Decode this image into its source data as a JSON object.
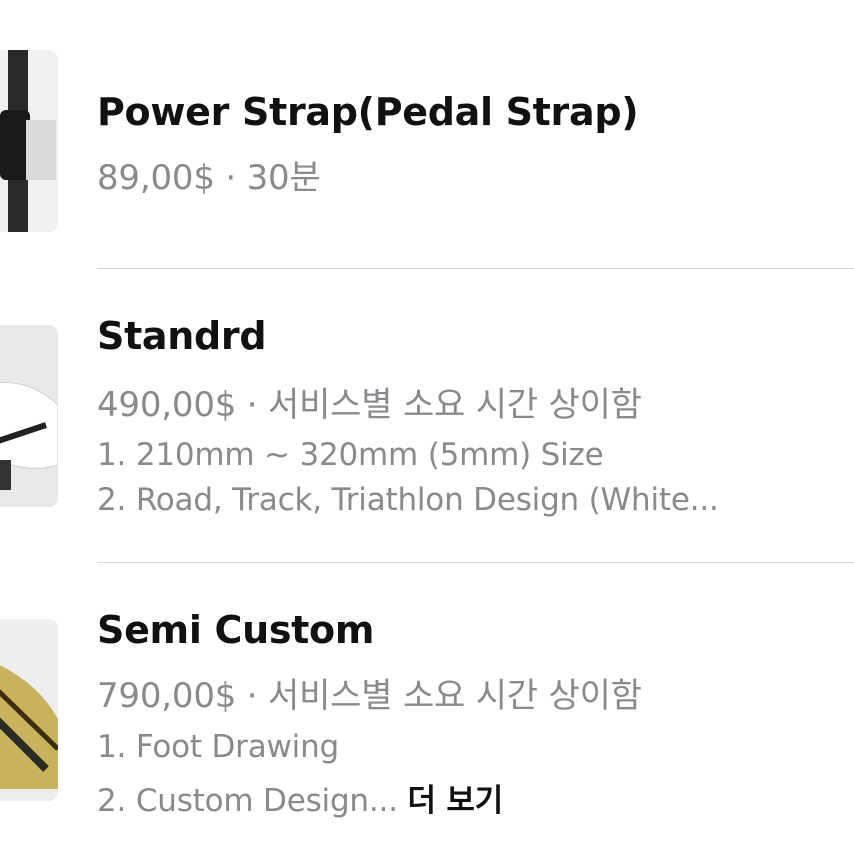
{
  "items": [
    {
      "title": "Power Strap(Pedal Strap)",
      "meta": "89,00$ · 30분",
      "desc1": "",
      "desc2": ""
    },
    {
      "title": "Standrd",
      "meta": "490,00$ · 서비스별 소요 시간 상이함",
      "desc1": "1. 210mm ~ 320mm (5mm) Size",
      "desc2": "2. Road, Track, Triathlon Design (White..."
    },
    {
      "title": "Semi Custom",
      "meta": "790,00$ · 서비스별 소요 시간 상이함",
      "desc1": "1. Foot Drawing",
      "desc2": "2. Custom Design...",
      "more": "더 보기"
    }
  ],
  "colors": {
    "title": "#111111",
    "secondary": "#8a8a8e",
    "divider": "#dcdcdc"
  }
}
